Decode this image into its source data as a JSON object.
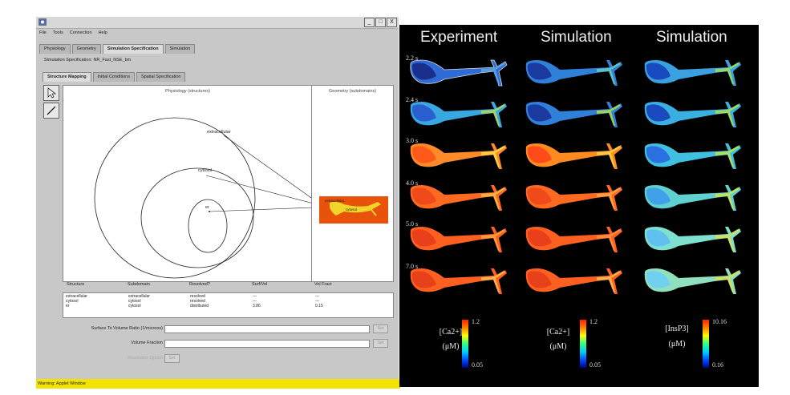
{
  "applet": {
    "title": "",
    "window_buttons": [
      "_",
      "□",
      "X"
    ],
    "menu": [
      "File",
      "Tools",
      "Connection",
      "Help"
    ],
    "main_tabs": [
      {
        "label": "Physiology",
        "active": false
      },
      {
        "label": "Geometry",
        "active": false
      },
      {
        "label": "Simulation Specification",
        "active": true
      },
      {
        "label": "Simulation",
        "active": false
      }
    ],
    "spec_label": "Simulation Specification:  NR_Fast_NSE_bm",
    "sub_tabs": [
      {
        "label": "Structure Mapping",
        "active": true
      },
      {
        "label": "Initial Conditions",
        "active": false
      },
      {
        "label": "Spatial Specification",
        "active": false
      }
    ],
    "physiology_title": "Physiology (structures)",
    "geometry_title": "Geometry (subdomains)",
    "structures": {
      "outer": "extracellular",
      "middle": "cytosol",
      "inner": "er"
    },
    "geometry_labels": [
      "extracellular",
      "cytosol"
    ],
    "table": {
      "headers": [
        "Structure",
        "Subdomain",
        "Resolved?",
        "Surf/Vol",
        "Vol Fract"
      ],
      "rows": [
        [
          "extracellular",
          "extracellular",
          "resolved",
          "---",
          "---"
        ],
        [
          "cytosol",
          "cytosol",
          "resolved",
          "---",
          "---"
        ],
        [
          "er",
          "cytosol",
          "distributed",
          "3.86",
          "0.15"
        ]
      ]
    },
    "form": {
      "surface_label": "Surface To Volume Ratio (1/microns)",
      "volume_label": "Volume Fraction",
      "set_label": "Set",
      "disabled_label": "Resolution Option",
      "resolve_label": "Set"
    },
    "status": "Warning: Applet Window",
    "colors": {
      "status": "#f2e400",
      "geometry_fill": "#e8520a"
    }
  },
  "figure": {
    "column_titles": [
      "Experiment",
      "Simulation",
      "Simulation"
    ],
    "times": [
      "2.2 s",
      "2.4 s",
      "3.0 s",
      "4.0 s",
      "5.0 s",
      "7.0 s"
    ],
    "colorbars": [
      {
        "label_top": "[Ca2+]",
        "label_bottom": "(μM)",
        "max": "1.2",
        "min": "0.05"
      },
      {
        "label_top": "[Ca2+]",
        "label_bottom": "(μM)",
        "max": "1.2",
        "min": "0.05"
      },
      {
        "label_top": "[InsP3]",
        "label_bottom": "(μM)",
        "max": "10.16",
        "min": "0.16"
      }
    ]
  }
}
